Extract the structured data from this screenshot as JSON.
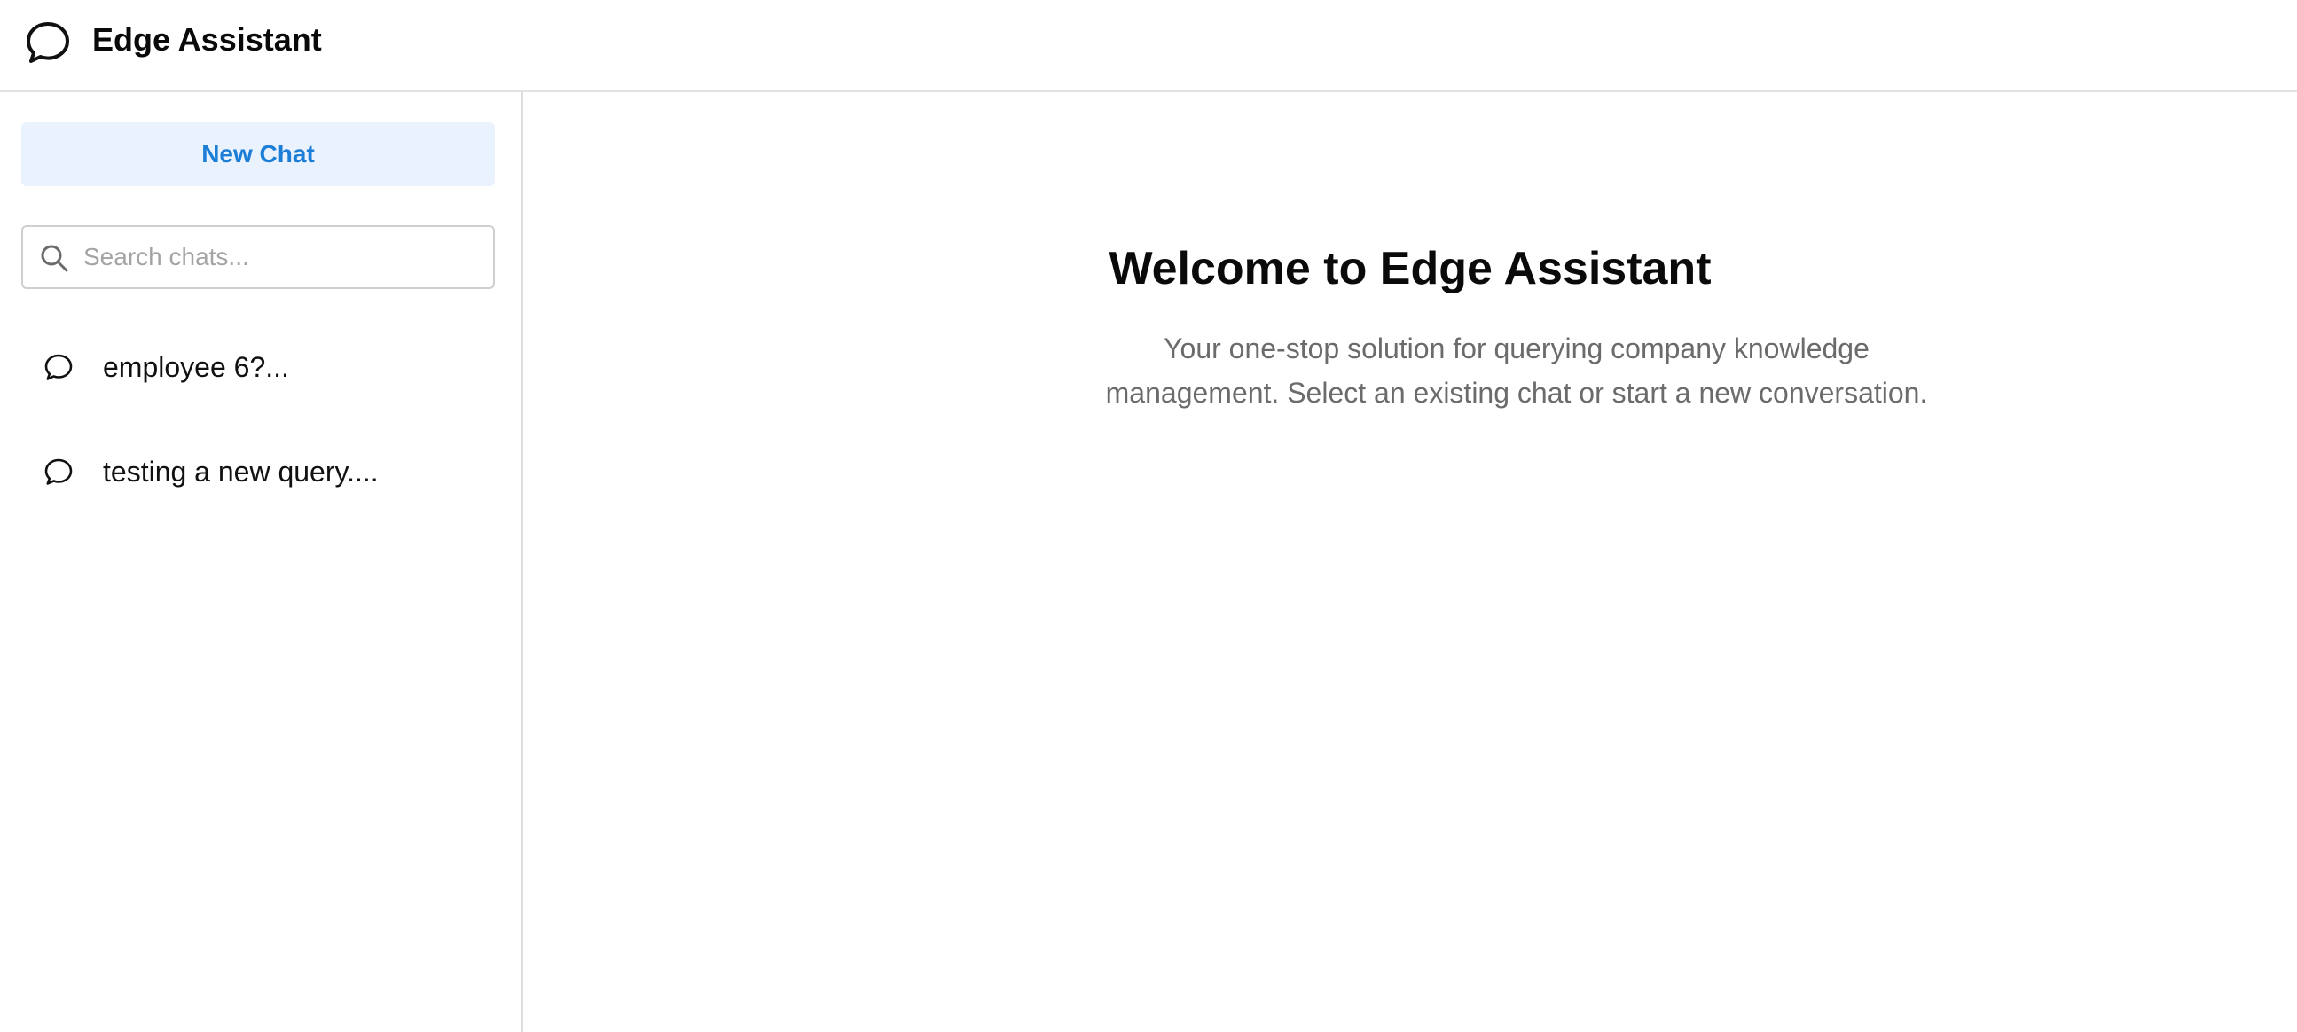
{
  "header": {
    "title": "Edge Assistant",
    "logo_icon": "chat-bubble-icon"
  },
  "sidebar": {
    "new_chat_label": "New Chat",
    "search": {
      "placeholder": "Search chats...",
      "value": "",
      "icon": "search-icon"
    },
    "chats": [
      {
        "label": "employee 6?...",
        "icon": "chat-bubble-icon"
      },
      {
        "label": "testing a new query....",
        "icon": "chat-bubble-icon"
      }
    ]
  },
  "main": {
    "title": "Welcome to Edge Assistant",
    "subtitle": "Your one-stop solution for querying company knowledge management. Select an existing chat or start a new conversation."
  },
  "colors": {
    "accent": "#1c7ed6",
    "button_bg": "#eaf2fd",
    "muted_text": "#6b6b6b",
    "border": "#dcdcdc"
  }
}
